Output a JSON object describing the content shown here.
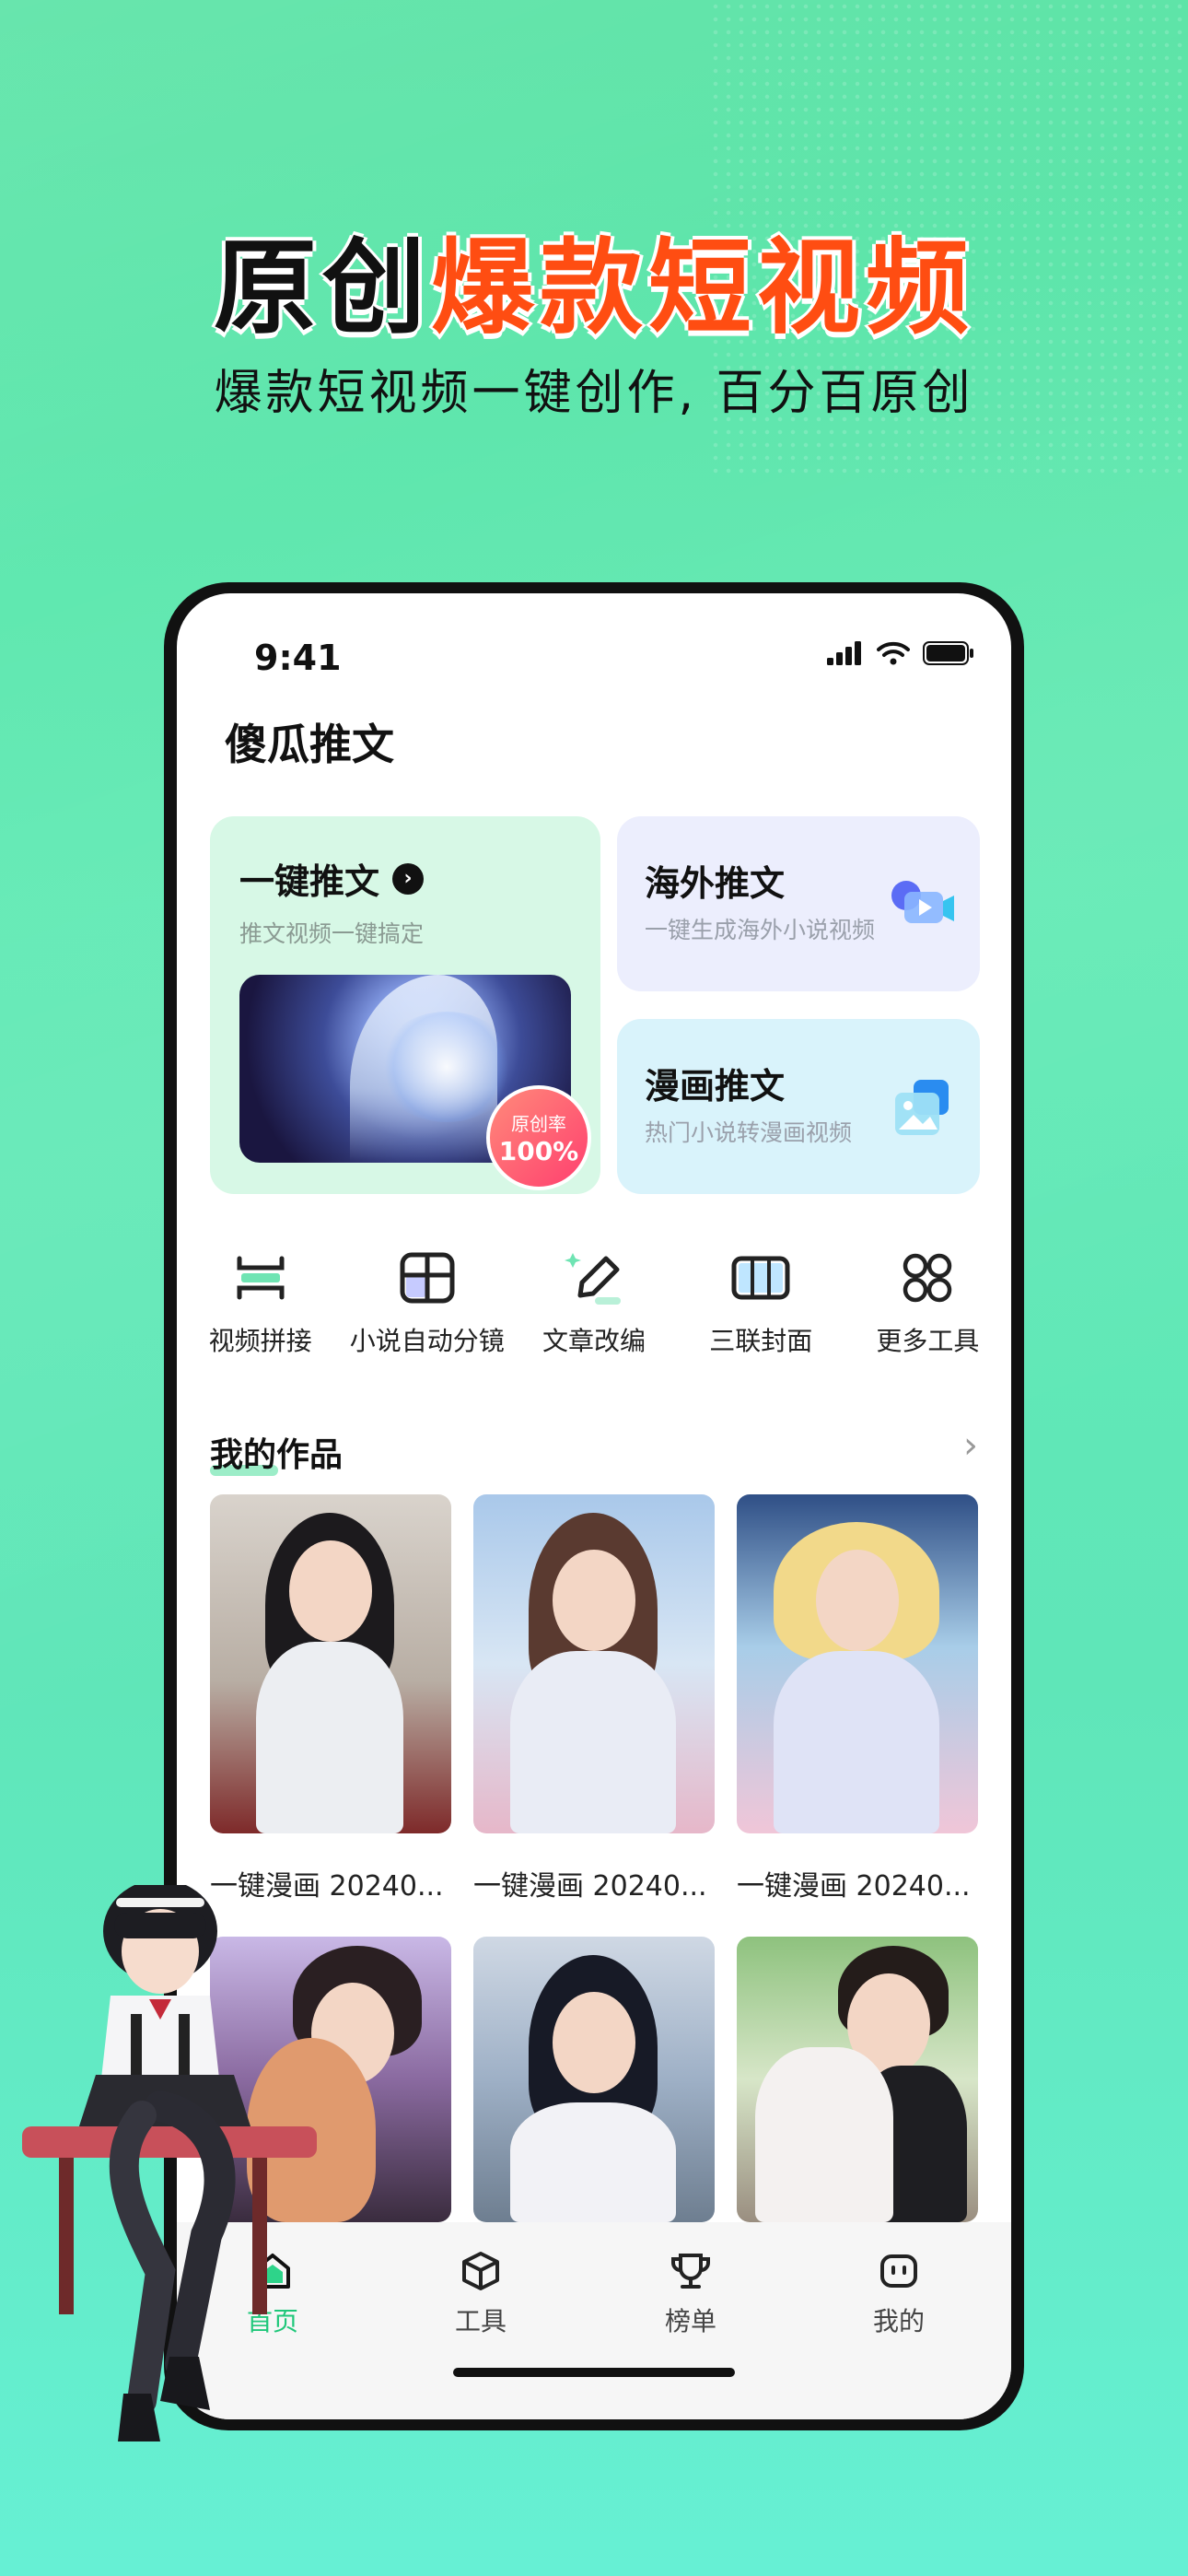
{
  "hero": {
    "title_black": "原创",
    "title_orange": "爆款短视频",
    "subtitle": "爆款短视频一键创作, 百分百原创"
  },
  "status_bar": {
    "time": "9:41"
  },
  "app": {
    "title": "傻瓜推文"
  },
  "cards": {
    "main": {
      "title": "一键推文",
      "subtitle": "推文视频一键搞定",
      "badge_line1": "原创率",
      "badge_line2": "100%"
    },
    "overseas": {
      "title": "海外推文",
      "subtitle": "一键生成海外小说视频",
      "icon": "video-camera-icon"
    },
    "comic": {
      "title": "漫画推文",
      "subtitle": "热门小说转漫画视频",
      "icon": "image-icon"
    }
  },
  "tools": [
    {
      "label": "视频拼接",
      "icon": "video-splice-icon"
    },
    {
      "label": "小说自动分镜",
      "icon": "storyboard-icon"
    },
    {
      "label": "文章改编",
      "icon": "pen-edit-icon"
    },
    {
      "label": "三联封面",
      "icon": "triptych-cover-icon"
    },
    {
      "label": "更多工具",
      "icon": "more-grid-icon"
    }
  ],
  "works": {
    "section_title": "我的作品",
    "items": [
      {
        "caption": "一键漫画 20240..."
      },
      {
        "caption": "一键漫画 20240..."
      },
      {
        "caption": "一键漫画 20240..."
      }
    ]
  },
  "tabbar": [
    {
      "label": "首页",
      "icon": "home-icon",
      "active": true
    },
    {
      "label": "工具",
      "icon": "cube-icon",
      "active": false
    },
    {
      "label": "榜单",
      "icon": "trophy-icon",
      "active": false
    },
    {
      "label": "我的",
      "icon": "profile-face-icon",
      "active": false
    }
  ],
  "colors": {
    "accent_green": "#1fc77a",
    "hero_orange": "#ff4d12",
    "bg_green": "#5fe6b0"
  }
}
